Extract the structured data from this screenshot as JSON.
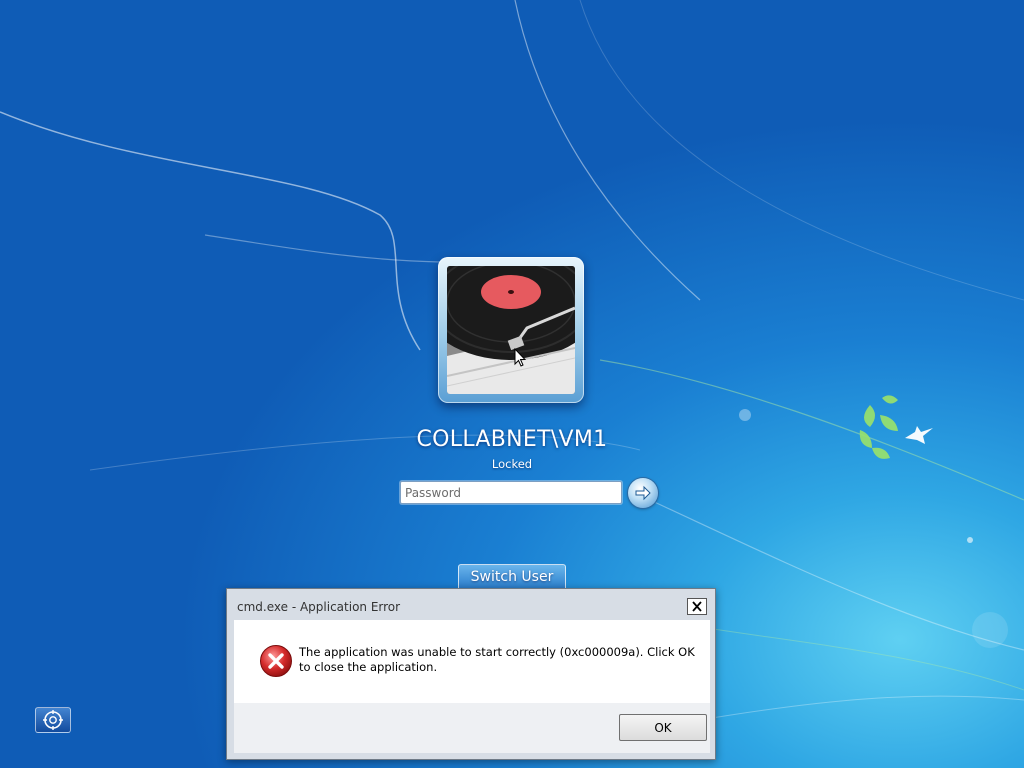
{
  "lock_screen": {
    "user_name": "COLLABNET\\VM1",
    "status": "Locked",
    "password_placeholder": "Password",
    "switch_user_label": "Switch User",
    "avatar_icon": "vinyl-record-turntable-icon",
    "submit_icon": "arrow-right-icon",
    "ease_of_access_icon": "ease-of-access-icon"
  },
  "error_dialog": {
    "title": "cmd.exe - Application Error",
    "message": "The application was unable to start correctly (0xc000009a). Click OK to close the application.",
    "ok_label": "OK",
    "icon": "error-x-icon",
    "close_icon": "close-icon"
  },
  "colors": {
    "wallpaper_blue": "#1a7fd2",
    "error_red": "#d42b2b"
  }
}
